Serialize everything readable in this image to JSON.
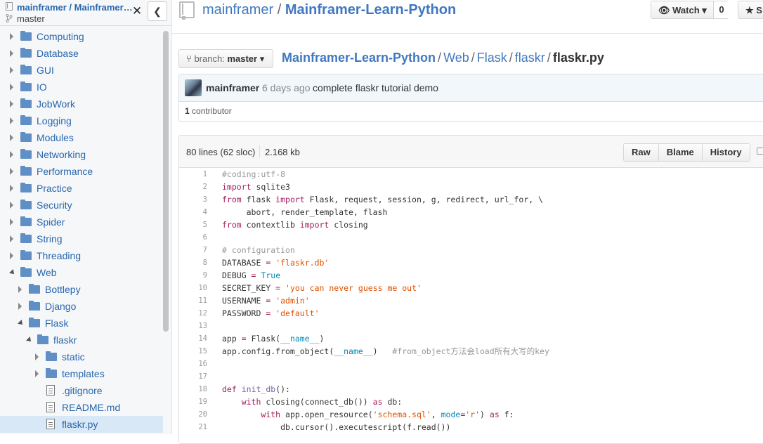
{
  "sidebar": {
    "repo_label": "mainframer / Mainframer-Learn-Python",
    "branch": "master",
    "tree": [
      {
        "label": "Computing",
        "type": "folder",
        "depth": 0,
        "expanded": false
      },
      {
        "label": "Database",
        "type": "folder",
        "depth": 0,
        "expanded": false
      },
      {
        "label": "GUI",
        "type": "folder",
        "depth": 0,
        "expanded": false
      },
      {
        "label": "IO",
        "type": "folder",
        "depth": 0,
        "expanded": false
      },
      {
        "label": "JobWork",
        "type": "folder",
        "depth": 0,
        "expanded": false
      },
      {
        "label": "Logging",
        "type": "folder",
        "depth": 0,
        "expanded": false
      },
      {
        "label": "Modules",
        "type": "folder",
        "depth": 0,
        "expanded": false
      },
      {
        "label": "Networking",
        "type": "folder",
        "depth": 0,
        "expanded": false
      },
      {
        "label": "Performance",
        "type": "folder",
        "depth": 0,
        "expanded": false
      },
      {
        "label": "Practice",
        "type": "folder",
        "depth": 0,
        "expanded": false
      },
      {
        "label": "Security",
        "type": "folder",
        "depth": 0,
        "expanded": false
      },
      {
        "label": "Spider",
        "type": "folder",
        "depth": 0,
        "expanded": false
      },
      {
        "label": "String",
        "type": "folder",
        "depth": 0,
        "expanded": false
      },
      {
        "label": "Threading",
        "type": "folder",
        "depth": 0,
        "expanded": false
      },
      {
        "label": "Web",
        "type": "folder",
        "depth": 0,
        "expanded": true
      },
      {
        "label": "Bottlepy",
        "type": "folder",
        "depth": 1,
        "expanded": false
      },
      {
        "label": "Django",
        "type": "folder",
        "depth": 1,
        "expanded": false
      },
      {
        "label": "Flask",
        "type": "folder",
        "depth": 1,
        "expanded": true
      },
      {
        "label": "flaskr",
        "type": "folder",
        "depth": 2,
        "expanded": true
      },
      {
        "label": "static",
        "type": "folder",
        "depth": 3,
        "expanded": false
      },
      {
        "label": "templates",
        "type": "folder",
        "depth": 3,
        "expanded": false
      },
      {
        "label": ".gitignore",
        "type": "file",
        "depth": 3
      },
      {
        "label": "README.md",
        "type": "file",
        "depth": 3
      },
      {
        "label": "flaskr.py",
        "type": "file",
        "depth": 3,
        "selected": true
      }
    ]
  },
  "header": {
    "owner": "mainframer",
    "separator": "/",
    "repo": "Mainframer-Learn-Python",
    "watch_label": "Watch",
    "watch_count": "0",
    "star_label": "S"
  },
  "branch_selector": {
    "prefix": "branch:",
    "name": "master"
  },
  "breadcrumb": {
    "parts": [
      "Mainframer-Learn-Python",
      "Web",
      "Flask",
      "flaskr"
    ],
    "file": "flaskr.py"
  },
  "commit": {
    "author": "mainframer",
    "time": "6 days ago",
    "message": "complete flaskr tutorial demo",
    "contributors_count": "1",
    "contributors_label": "contributor"
  },
  "file": {
    "lines_info": "80 lines (62 sloc)",
    "size": "2.168 kb",
    "actions": [
      "Raw",
      "Blame",
      "History"
    ]
  },
  "code_lines": [
    [
      [
        "c",
        "#coding:utf-8"
      ]
    ],
    [
      [
        "k",
        "import"
      ],
      [
        "",
        " sqlite3"
      ]
    ],
    [
      [
        "k",
        "from"
      ],
      [
        "",
        " flask "
      ],
      [
        "k",
        "import"
      ],
      [
        "",
        " Flask, request, session, g, redirect, url_for, \\"
      ]
    ],
    [
      [
        "",
        "     abort, render_template, flash"
      ]
    ],
    [
      [
        "k",
        "from"
      ],
      [
        "",
        " contextlib "
      ],
      [
        "k",
        "import"
      ],
      [
        "",
        " closing"
      ]
    ],
    [],
    [
      [
        "c",
        "# configuration"
      ]
    ],
    [
      [
        "",
        "DATABASE "
      ],
      [
        "k",
        "="
      ],
      [
        "",
        " "
      ],
      [
        "s",
        "'flaskr.db'"
      ]
    ],
    [
      [
        "",
        "DEBUG "
      ],
      [
        "k",
        "="
      ],
      [
        "",
        " "
      ],
      [
        "n",
        "True"
      ]
    ],
    [
      [
        "",
        "SECRET_KEY "
      ],
      [
        "k",
        "="
      ],
      [
        "",
        " "
      ],
      [
        "s",
        "'you can never guess me out'"
      ]
    ],
    [
      [
        "",
        "USERNAME "
      ],
      [
        "k",
        "="
      ],
      [
        "",
        " "
      ],
      [
        "s",
        "'admin'"
      ]
    ],
    [
      [
        "",
        "PASSWORD "
      ],
      [
        "k",
        "="
      ],
      [
        "",
        " "
      ],
      [
        "s",
        "'default'"
      ]
    ],
    [],
    [
      [
        "",
        "app "
      ],
      [
        "k",
        "="
      ],
      [
        "",
        " Flask("
      ],
      [
        "n",
        "__name__"
      ],
      [
        "",
        ")"
      ]
    ],
    [
      [
        "",
        "app.config.from_object("
      ],
      [
        "n",
        "__name__"
      ],
      [
        "",
        ")   "
      ],
      [
        "c",
        "#from_object方法会load所有大写的key"
      ]
    ],
    [],
    [],
    [
      [
        "k",
        "def"
      ],
      [
        "",
        " "
      ],
      [
        "f",
        "init_db"
      ],
      [
        "",
        "():"
      ]
    ],
    [
      [
        "",
        "    "
      ],
      [
        "k",
        "with"
      ],
      [
        "",
        " closing(connect_db()) "
      ],
      [
        "k",
        "as"
      ],
      [
        "",
        " db:"
      ]
    ],
    [
      [
        "",
        "        "
      ],
      [
        "k",
        "with"
      ],
      [
        "",
        " app.open_resource("
      ],
      [
        "s",
        "'schema.sql'"
      ],
      [
        "",
        ", "
      ],
      [
        "n",
        "mode"
      ],
      [
        "k",
        "="
      ],
      [
        "s",
        "'r'"
      ],
      [
        "",
        ") "
      ],
      [
        "k",
        "as"
      ],
      [
        "",
        " f:"
      ]
    ],
    [
      [
        "",
        "            db.cursor().executescript(f.read())"
      ]
    ]
  ]
}
